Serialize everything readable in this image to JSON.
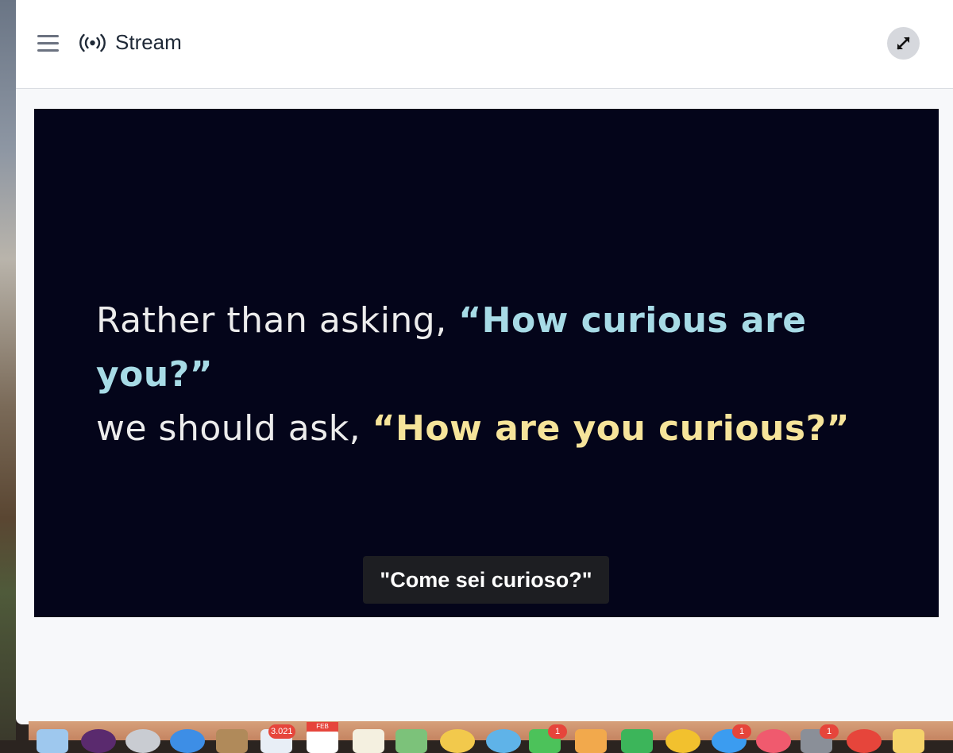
{
  "header": {
    "title": "Stream",
    "menu_icon": "hamburger-menu-icon",
    "stream_icon": "broadcast-icon",
    "expand_icon": "expand-arrows-icon"
  },
  "video": {
    "line1_plain": "Rather than asking, ",
    "line1_quote": "“How curious are you?”",
    "line2_plain": "we should ask, ",
    "line2_quote": "“How are you curious?”",
    "subtitle": "\"Come sei curioso?\""
  },
  "dock": {
    "mail_badge": "3.021",
    "calendar_month": "FEB",
    "badges": [
      "1",
      "1",
      "1",
      "1"
    ]
  },
  "colors": {
    "video_background": "#04051a",
    "quote_blue": "#a7dbe6",
    "quote_yellow": "#f6e49a"
  }
}
